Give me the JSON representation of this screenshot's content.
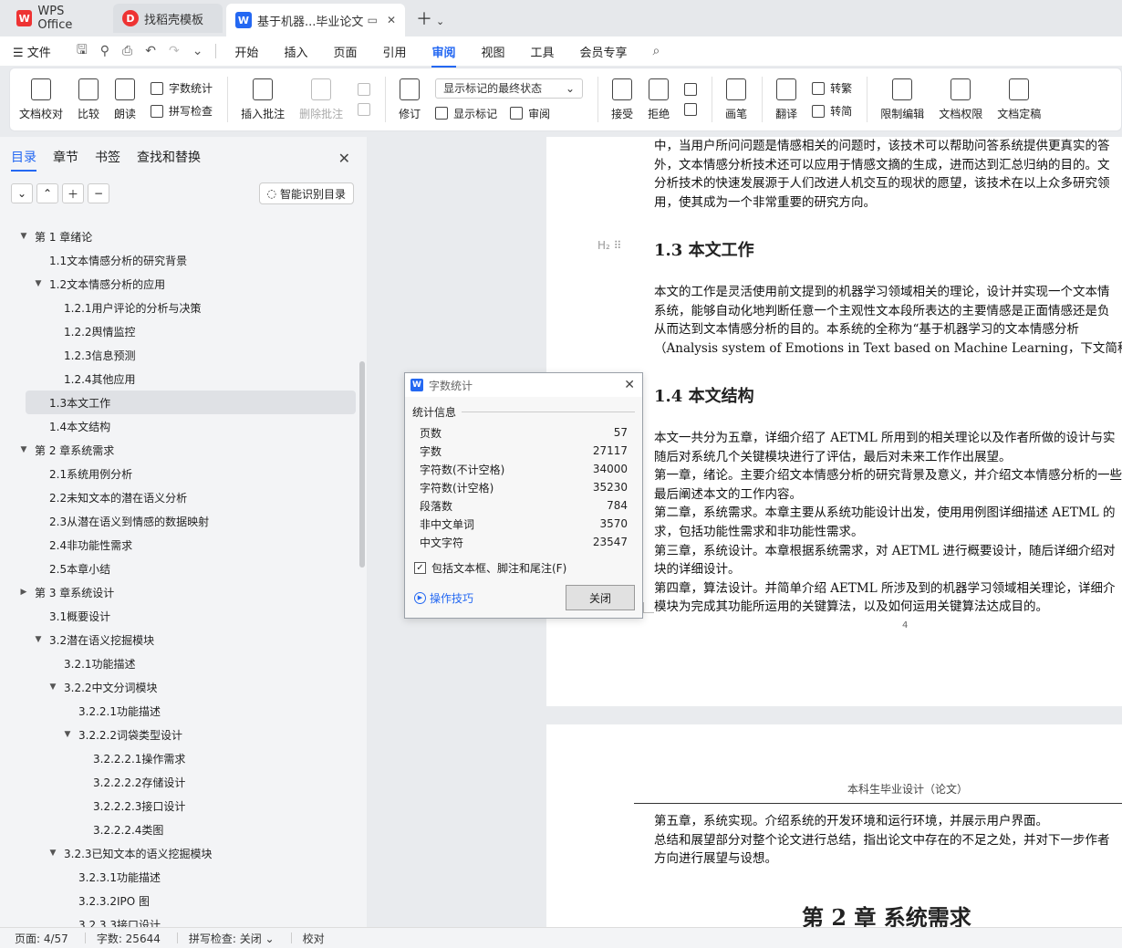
{
  "tabs": {
    "wps": "WPS Office",
    "daoke": "找稻壳模板",
    "doc": "基于机器...毕业论文"
  },
  "menu": {
    "file": "文件",
    "items": [
      "开始",
      "插入",
      "页面",
      "引用",
      "审阅",
      "视图",
      "工具",
      "会员专享"
    ],
    "active": "审阅"
  },
  "ribbon": {
    "doc_check": "文档校对",
    "compare": "比较",
    "read_aloud": "朗读",
    "word_count": "字数统计",
    "spell_check": "拼写检查",
    "insert_comment": "插入批注",
    "delete_comment": "删除批注",
    "track": "修订",
    "markup_state": "显示标记的最终状态",
    "show_markup": "显示标记",
    "review_pane": "审阅",
    "accept": "接受",
    "reject": "拒绝",
    "pen": "画笔",
    "translate": "翻译",
    "trad": "转繁",
    "simp": "转简",
    "restrict": "限制编辑",
    "permission": "文档权限",
    "finalize": "文档定稿"
  },
  "left_panel": {
    "tabs": [
      "目录",
      "章节",
      "书签",
      "查找和替换"
    ],
    "smart_toc": "智能识别目录",
    "toc": [
      {
        "label": "第 1 章绪论",
        "level": 0,
        "arrow": "▼"
      },
      {
        "label": "1.1文本情感分析的研究背景",
        "level": 1,
        "arrow": ""
      },
      {
        "label": "1.2文本情感分析的应用",
        "level": 1,
        "arrow": "▼"
      },
      {
        "label": "1.2.1用户评论的分析与决策",
        "level": 2,
        "arrow": ""
      },
      {
        "label": "1.2.2舆情监控",
        "level": 2,
        "arrow": ""
      },
      {
        "label": "1.2.3信息预测",
        "level": 2,
        "arrow": ""
      },
      {
        "label": "1.2.4其他应用",
        "level": 2,
        "arrow": ""
      },
      {
        "label": "1.3本文工作",
        "level": 1,
        "arrow": "",
        "selected": true
      },
      {
        "label": "1.4本文结构",
        "level": 1,
        "arrow": ""
      },
      {
        "label": "第 2 章系统需求",
        "level": 0,
        "arrow": "▼"
      },
      {
        "label": "2.1系统用例分析",
        "level": 1,
        "arrow": ""
      },
      {
        "label": "2.2未知文本的潜在语义分析",
        "level": 1,
        "arrow": ""
      },
      {
        "label": "2.3从潜在语义到情感的数据映射",
        "level": 1,
        "arrow": ""
      },
      {
        "label": "2.4非功能性需求",
        "level": 1,
        "arrow": ""
      },
      {
        "label": "2.5本章小结",
        "level": 1,
        "arrow": ""
      },
      {
        "label": "第 3 章系统设计",
        "level": 0,
        "arrow": "▶"
      },
      {
        "label": "3.1概要设计",
        "level": 1,
        "arrow": ""
      },
      {
        "label": "3.2潜在语义挖掘模块",
        "level": 1,
        "arrow": "▼"
      },
      {
        "label": "3.2.1功能描述",
        "level": 2,
        "arrow": ""
      },
      {
        "label": "3.2.2中文分词模块",
        "level": 2,
        "arrow": "▼"
      },
      {
        "label": "3.2.2.1功能描述",
        "level": 3,
        "arrow": ""
      },
      {
        "label": "3.2.2.2词袋类型设计",
        "level": 3,
        "arrow": "▼"
      },
      {
        "label": "3.2.2.2.1操作需求",
        "level": 4,
        "arrow": ""
      },
      {
        "label": "3.2.2.2.2存储设计",
        "level": 4,
        "arrow": ""
      },
      {
        "label": "3.2.2.2.3接口设计",
        "level": 4,
        "arrow": ""
      },
      {
        "label": "3.2.2.2.4类图",
        "level": 4,
        "arrow": ""
      },
      {
        "label": "3.2.3已知文本的语义挖掘模块",
        "level": 2,
        "arrow": "▼"
      },
      {
        "label": "3.2.3.1功能描述",
        "level": 3,
        "arrow": ""
      },
      {
        "label": "3.2.3.2IPO 图",
        "level": 3,
        "arrow": ""
      },
      {
        "label": "3.2.3.3接口设计",
        "level": 3,
        "arrow": ""
      }
    ]
  },
  "document": {
    "page1_top_lines": [
      "中，当用户所问问题是情感相关的问题时，该技术可以帮助问答系统提供更真实的答",
      "外，文本情感分析技术还可以应用于情感文摘的生成，进而达到汇总归纳的目的。文",
      "分析技术的快速发展源于人们改进人机交互的现状的愿望，该技术在以上众多研究领",
      "用，使其成为一个非常重要的研究方向。"
    ],
    "h13": "1.3  本文工作",
    "h13_lines": [
      "本文的工作是灵活使用前文提到的机器学习领域相关的理论，设计并实现一个文本情",
      "系统，能够自动化地判断任意一个主观性文本段所表达的主要情感是正面情感还是负",
      "从而达到文本情感分析的目的。本系统的全称为“基于机器学习的文本情感分析",
      "（Analysis system of Emotions in Text based on Machine Learning，下文简称“AETML”"
    ],
    "h14": "1.4  本文结构",
    "h14_lines": [
      "本文一共分为五章，详细介绍了 AETML 所用到的相关理论以及作者所做的设计与实",
      "随后对系统几个关键模块进行了评估，最后对未来工作作出展望。",
      "第一章，绪论。主要介绍文本情感分析的研究背景及意义，并介绍文本情感分析的一些",
      "最后阐述本文的工作内容。",
      "第二章，系统需求。本章主要从系统功能设计出发，使用用例图详细描述 AETML 的",
      "求，包括功能性需求和非功能性需求。",
      "第三章，系统设计。本章根据系统需求，对 AETML 进行概要设计，随后详细介绍对",
      "块的详细设计。",
      "第四章，算法设计。并简单介绍 AETML 所涉及到的机器学习领域相关理论，详细介",
      "模块为完成其功能所运用的关键算法，以及如何运用关键算法达成目的。"
    ],
    "page_number": "4",
    "page2_header": "本科生毕业设计（论文）",
    "page2_lines": [
      "第五章，系统实现。介绍系统的开发环境和运行环境，并展示用户界面。",
      "总结和展望部分对整个论文进行总结，指出论文中存在的不足之处，并对下一步作者",
      "方向进行展望与设想。"
    ],
    "chapter2": "第 2 章   系统需求"
  },
  "dialog": {
    "title": "字数统计",
    "section": "统计信息",
    "stats": [
      {
        "label": "页数",
        "value": "57"
      },
      {
        "label": "字数",
        "value": "27117"
      },
      {
        "label": "字符数(不计空格)",
        "value": "34000"
      },
      {
        "label": "字符数(计空格)",
        "value": "35230"
      },
      {
        "label": "段落数",
        "value": "784"
      },
      {
        "label": "非中文单词",
        "value": "3570"
      },
      {
        "label": "中文字符",
        "value": "23547"
      }
    ],
    "include_label": "包括文本框、脚注和尾注(F)",
    "tips": "操作技巧",
    "close": "关闭"
  },
  "status": {
    "page": "页面: 4/57",
    "words": "字数: 25644",
    "spell": "拼写检查: 关闭",
    "proof": "校对"
  }
}
